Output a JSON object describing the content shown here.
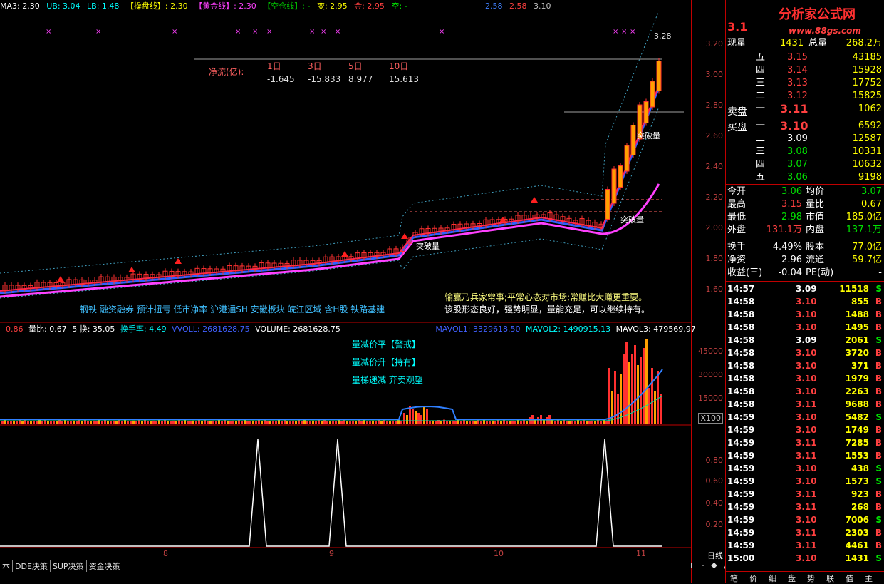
{
  "header": {
    "ma3": "MA3: 2.30",
    "ub": "UB: 3.04",
    "lb": "LB: 1.48",
    "caopan": "【操盘线】: 2.30",
    "huangjin": "【黄金线】: 2.30",
    "kongcang": "【空仓线】: -",
    "bian": "变: 2.95",
    "jin": "金: 2.95",
    "kong": "空: -",
    "v1": "2.58",
    "v2": "2.58",
    "v3": "3.10"
  },
  "logo": {
    "title": "分析家公式网",
    "url": "www.88gs.com"
  },
  "price_panel": {
    "net_flow_label": "净流(亿):",
    "flows": [
      {
        "period": "1日",
        "value": "-1.645"
      },
      {
        "period": "3日",
        "value": "-15.833"
      },
      {
        "period": "5日",
        "value": "8.977"
      },
      {
        "period": "10日",
        "value": "15.613"
      }
    ],
    "high_label": "3.28",
    "breakthrough_labels": [
      "突破量",
      "突破量",
      "突破量"
    ],
    "concepts": "钢铁 融资融券 预计扭亏 低市净率 沪港通SH 安徽板块 皖江区域 含H股 铁路基建",
    "comment1": "输赢乃兵家常事;平常心态对市场;常赚比大赚更重要。",
    "comment2": "该股形态良好，强势明显，量能充足，可以继续持有。",
    "price_ticks": [
      "3.20",
      "3.00",
      "2.80",
      "2.60",
      "2.40",
      "2.20",
      "2.00",
      "1.80",
      "1.60"
    ]
  },
  "volume_panel": {
    "header": {
      "a": "0.86",
      "liangbi": "量比: 0.67",
      "huan": "5 换: 35.05",
      "turnover": "换手率: 4.49",
      "vvoll": "VVOLL: 2681628.75",
      "volume": "VOLUME: 2681628.75",
      "mavol1": "MAVOL1: 3329618.50",
      "mavol2": "MAVOL2: 1490915.13",
      "mavol3": "MAVOL3: 479569.97"
    },
    "notes": [
      "量减价平【警戒】",
      "量减价升【持有】",
      "量梯递减 弃卖观望"
    ],
    "ticks": [
      "45000",
      "30000",
      "15000"
    ],
    "unit": "X100"
  },
  "indicator_panel": {
    "ticks": [
      "0.80",
      "0.60",
      "0.40",
      "0.20"
    ]
  },
  "x_axis": {
    "labels": [
      "8",
      "9",
      "10",
      "11"
    ],
    "period": "日线"
  },
  "bottom_tabs": [
    "本",
    "DDE决策",
    "SUP决策",
    "资金决策"
  ],
  "nav_controls": [
    "+",
    "-",
    "◆",
    "▲"
  ],
  "quote": {
    "price": "3.1",
    "xianliang_label": "现量",
    "xianliang": "1431",
    "zongliang_label": "总量",
    "zongliang": "268.2万",
    "sell_label": "卖盘",
    "buy_label": "买盘",
    "asks": [
      {
        "level": "五",
        "price": "3.15",
        "vol": "43185"
      },
      {
        "level": "四",
        "price": "3.14",
        "vol": "15928"
      },
      {
        "level": "三",
        "price": "3.13",
        "vol": "17752"
      },
      {
        "level": "二",
        "price": "3.12",
        "vol": "15825"
      },
      {
        "level": "一",
        "price": "3.11",
        "vol": "1062"
      }
    ],
    "bids": [
      {
        "level": "一",
        "price": "3.10",
        "vol": "6592"
      },
      {
        "level": "二",
        "price": "3.09",
        "vol": "12587"
      },
      {
        "level": "三",
        "price": "3.08",
        "vol": "10331"
      },
      {
        "level": "四",
        "price": "3.07",
        "vol": "10632"
      },
      {
        "level": "五",
        "price": "3.06",
        "vol": "9198"
      }
    ],
    "stats": [
      {
        "l1": "今开",
        "v1": "3.06",
        "l2": "均价",
        "v2": "3.07"
      },
      {
        "l1": "最高",
        "v1": "3.15",
        "l2": "量比",
        "v2": "0.67"
      },
      {
        "l1": "最低",
        "v1": "2.98",
        "l2": "市值",
        "v2": "185.0亿"
      },
      {
        "l1": "外盘",
        "v1": "131.1万",
        "l2": "内盘",
        "v2": "137.1万"
      }
    ],
    "stats2": [
      {
        "l1": "换手",
        "v1": "4.49%",
        "l2": "股本",
        "v2": "77.0亿"
      },
      {
        "l1": "净资",
        "v1": "2.96",
        "l2": "流通",
        "v2": "59.7亿"
      },
      {
        "l1": "收益(三)",
        "v1": "-0.04",
        "l2": "PE(动)",
        "v2": "-"
      }
    ]
  },
  "ticks": [
    {
      "t": "14:57",
      "p": "3.09",
      "v": "11518",
      "s": "S"
    },
    {
      "t": "14:58",
      "p": "3.10",
      "v": "855",
      "s": "B"
    },
    {
      "t": "14:58",
      "p": "3.10",
      "v": "1488",
      "s": "B"
    },
    {
      "t": "14:58",
      "p": "3.10",
      "v": "1495",
      "s": "B"
    },
    {
      "t": "14:58",
      "p": "3.09",
      "v": "2061",
      "s": "S"
    },
    {
      "t": "14:58",
      "p": "3.10",
      "v": "3720",
      "s": "B"
    },
    {
      "t": "14:58",
      "p": "3.10",
      "v": "371",
      "s": "B"
    },
    {
      "t": "14:58",
      "p": "3.10",
      "v": "1979",
      "s": "B"
    },
    {
      "t": "14:58",
      "p": "3.10",
      "v": "2263",
      "s": "B"
    },
    {
      "t": "14:58",
      "p": "3.11",
      "v": "9688",
      "s": "B"
    },
    {
      "t": "14:59",
      "p": "3.10",
      "v": "5482",
      "s": "S"
    },
    {
      "t": "14:59",
      "p": "3.10",
      "v": "1749",
      "s": "B"
    },
    {
      "t": "14:59",
      "p": "3.11",
      "v": "7285",
      "s": "B"
    },
    {
      "t": "14:59",
      "p": "3.11",
      "v": "1553",
      "s": "B"
    },
    {
      "t": "14:59",
      "p": "3.10",
      "v": "438",
      "s": "S"
    },
    {
      "t": "14:59",
      "p": "3.10",
      "v": "1573",
      "s": "S"
    },
    {
      "t": "14:59",
      "p": "3.11",
      "v": "923",
      "s": "B"
    },
    {
      "t": "14:59",
      "p": "3.11",
      "v": "268",
      "s": "B"
    },
    {
      "t": "14:59",
      "p": "3.10",
      "v": "7006",
      "s": "S"
    },
    {
      "t": "14:59",
      "p": "3.11",
      "v": "2303",
      "s": "B"
    },
    {
      "t": "14:59",
      "p": "3.11",
      "v": "4461",
      "s": "B"
    },
    {
      "t": "15:00",
      "p": "3.10",
      "v": "1431",
      "s": "S"
    }
  ],
  "right_tabs": [
    "笔",
    "价",
    "细",
    "盘",
    "势",
    "联",
    "值",
    "主"
  ]
}
